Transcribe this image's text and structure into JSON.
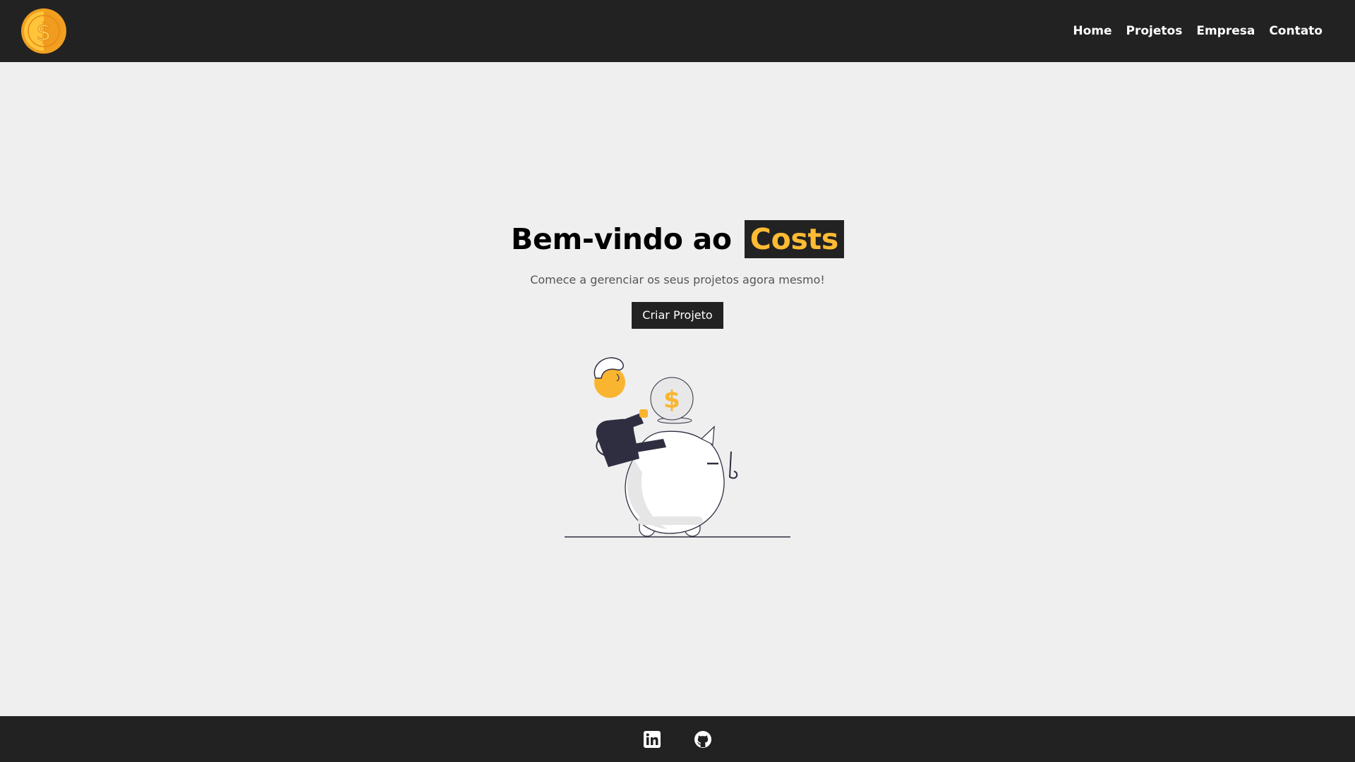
{
  "navbar": {
    "logo_icon": "coin-dollar-icon",
    "links": [
      {
        "label": "Home"
      },
      {
        "label": "Projetos"
      },
      {
        "label": "Empresa"
      },
      {
        "label": "Contato"
      }
    ]
  },
  "hero": {
    "title_prefix": "Bem-vindo ao",
    "title_brand": "Costs",
    "subtitle": "Comece a gerenciar os seus projetos agora mesmo!",
    "cta_label": "Criar Projeto",
    "illustration": "piggy-bank-savings-illustration"
  },
  "footer": {
    "icons": [
      "linkedin-icon",
      "github-icon"
    ]
  },
  "colors": {
    "dark": "#222222",
    "accent": "#ffbb33",
    "background": "#efefef"
  }
}
